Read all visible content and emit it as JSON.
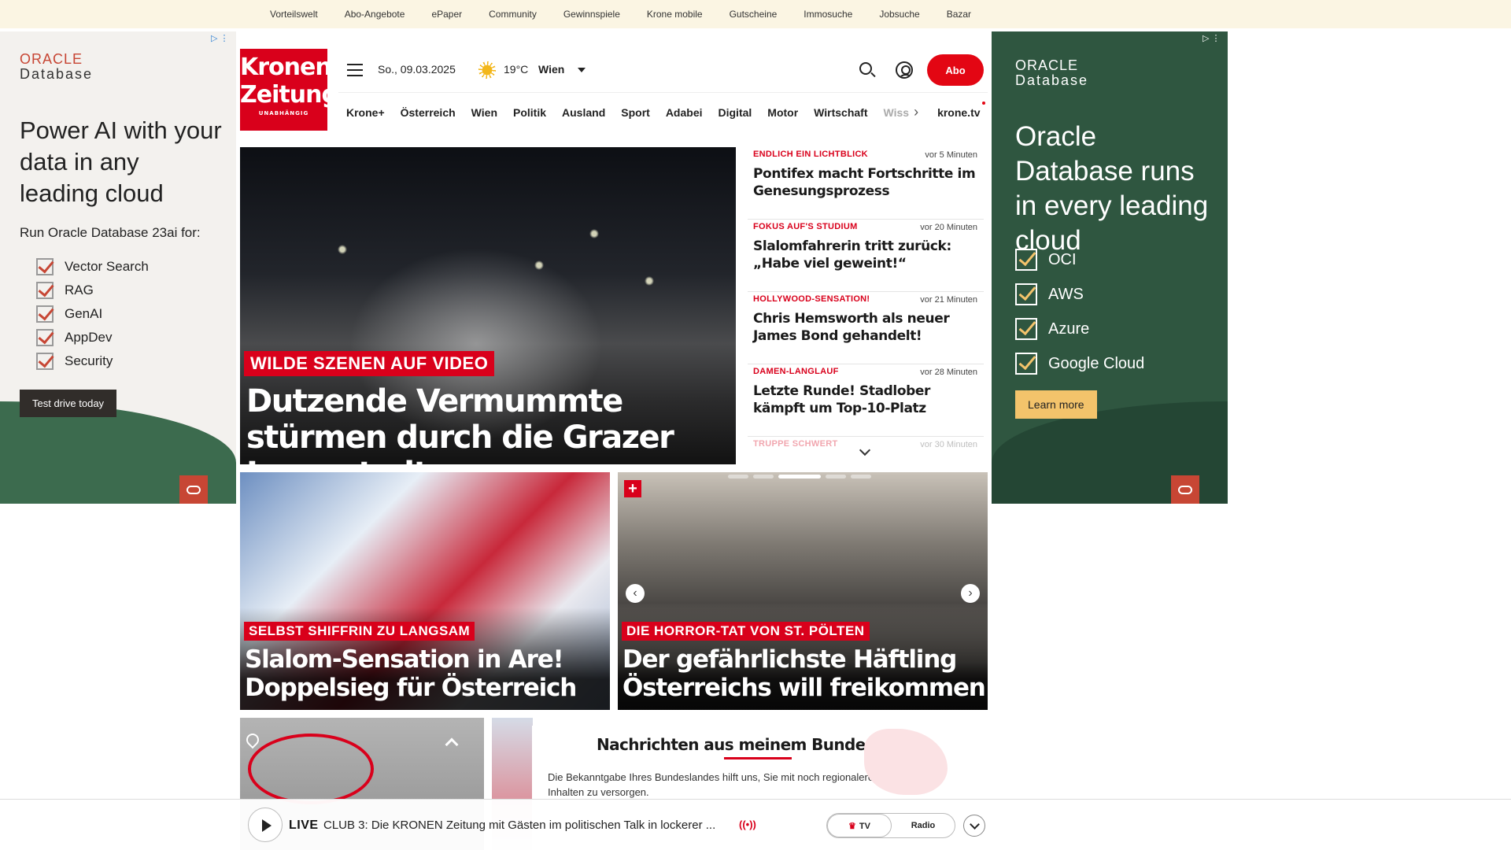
{
  "topbar": {
    "links": [
      "Vorteilswelt",
      "Abo-Angebote",
      "ePaper",
      "Community",
      "Gewinnspiele",
      "Krone mobile",
      "Gutscheine",
      "Immosuche",
      "Jobsuche",
      "Bazar"
    ]
  },
  "ad_left": {
    "brand_top": "ORACLE",
    "brand_bottom": "Database",
    "headline": "Power AI with your data in any leading cloud",
    "sub": "Run Oracle Database 23ai for:",
    "items": [
      "Vector Search",
      "RAG",
      "GenAI",
      "AppDev",
      "Security"
    ],
    "cta": "Test drive today"
  },
  "ad_right": {
    "brand_top": "ORACLE",
    "brand_bottom": "Database",
    "headline": "Oracle Database runs in every leading cloud",
    "items": [
      "OCI",
      "AWS",
      "Azure",
      "Google Cloud"
    ],
    "cta": "Learn more"
  },
  "header": {
    "logo_line1": "Kronen",
    "logo_line2": "Zeitung",
    "logo_tagline": "UNABHÄNGIG",
    "date": "So., 09.03.2025",
    "temperature": "19°C",
    "city": "Wien",
    "abo_label": "Abo"
  },
  "nav": {
    "items": [
      "Krone+",
      "Österreich",
      "Wien",
      "Politik",
      "Ausland",
      "Sport",
      "Adabei",
      "Digital",
      "Motor",
      "Wirtschaft"
    ],
    "faded_item": "Wiss",
    "kronetv": "krone.tv"
  },
  "hero": {
    "kicker": "WILDE SZENEN AUF VIDEO",
    "title": "Dutzende Vermummte stürmen durch die Grazer Innenstadt"
  },
  "ticker": [
    {
      "cat": "ENDLICH EIN LICHTBLICK",
      "time": "vor 5 Minuten",
      "head": "Pontifex macht Fortschritte im Genesungsprozess"
    },
    {
      "cat": "FOKUS AUF'S STUDIUM",
      "time": "vor 20 Minuten",
      "head": "Slalomfahrerin tritt zurück: „Habe viel geweint!“"
    },
    {
      "cat": "HOLLYWOOD-SENSATION!",
      "time": "vor 21 Minuten",
      "head": "Chris Hemsworth als neuer James Bond gehandelt!"
    },
    {
      "cat": "DAMEN-LANGLAUF",
      "time": "vor 28 Minuten",
      "head": "Letzte Runde! Stadlober kämpft um Top-10-Platz"
    },
    {
      "cat": "TRUPPE SCHWERT",
      "time": "vor 30 Minuten",
      "head": ""
    }
  ],
  "tiles": [
    {
      "kicker": "SELBST SHIFFRIN ZU LANGSAM",
      "title": "Slalom-Sensation in Are! Doppelsieg für Österreich"
    },
    {
      "kicker": "DIE HORROR-TAT VON ST. PÖLTEN",
      "title": "Der gefährlichste Häftling Österreichs will freikommen",
      "badge": "+"
    }
  ],
  "bundesland": {
    "title": "Nachrichten aus meinem Bundesland",
    "text": "Die Bekanntgabe Ihres Bundeslandes hilft uns, Sie mit noch regionaleren Inhalten zu versorgen."
  },
  "player": {
    "live": "LIVE",
    "text": "CLUB 3: Die KRONEN Zeitung mit Gästen im politischen Talk in lockerer ...",
    "radio_indicator": "((•))",
    "tv_label": "TV",
    "radio_label": "Radio"
  },
  "colors": {
    "brand_red": "#d9001b",
    "topbar_bg": "#fbf5e3",
    "oracle_green": "#2f5640"
  }
}
